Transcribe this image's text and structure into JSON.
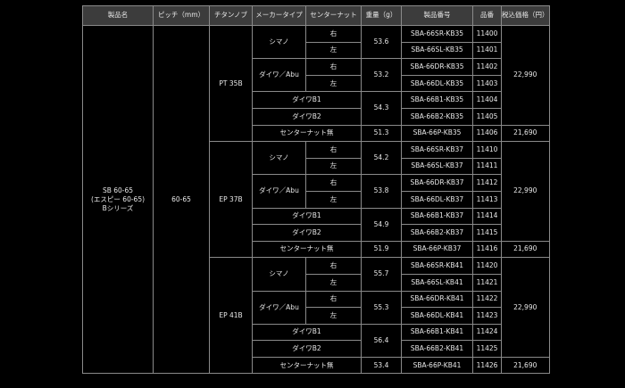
{
  "headers": [
    "製品名",
    "ピッチ（mm）",
    "チタンノブ",
    "メーカータイプ",
    "センターナット",
    "重量（g）",
    "製品番号",
    "品番",
    "税込価格（円）"
  ],
  "product_name": [
    "SB 60-65",
    "(エスピー 60-65)",
    "Bシリーズ"
  ],
  "pitch": "60-65",
  "groups": [
    {
      "knob": "PT 35B",
      "rows": [
        {
          "maker": "シマノ",
          "nut": "右",
          "weight": "53.6",
          "sku": "SBA-66SR-KB35",
          "code": "11400"
        },
        {
          "nut": "左",
          "sku": "SBA-66SL-KB35",
          "code": "11401"
        },
        {
          "maker": "ダイワ／Abu",
          "nut": "右",
          "weight": "53.2",
          "sku": "SBA-66DR-KB35",
          "code": "11402"
        },
        {
          "nut": "左",
          "sku": "SBA-66DL-KB35",
          "code": "11403"
        },
        {
          "maker": "ダイワB1",
          "weight": "54.3",
          "sku": "SBA-66B1-KB35",
          "code": "11404"
        },
        {
          "maker": "ダイワB2",
          "sku": "SBA-66B2-KB35",
          "code": "11405"
        },
        {
          "maker": "センターナット無",
          "weight": "51.3",
          "sku": "SBA-66P-KB35",
          "code": "11406"
        }
      ],
      "price_main": "22,990",
      "price_last": "21,690"
    },
    {
      "knob": "EP 37B",
      "rows": [
        {
          "maker": "シマノ",
          "nut": "右",
          "weight": "54.2",
          "sku": "SBA-66SR-KB37",
          "code": "11410"
        },
        {
          "nut": "左",
          "sku": "SBA-66SL-KB37",
          "code": "11411"
        },
        {
          "maker": "ダイワ／Abu",
          "nut": "右",
          "weight": "53.8",
          "sku": "SBA-66DR-KB37",
          "code": "11412"
        },
        {
          "nut": "左",
          "sku": "SBA-66DL-KB37",
          "code": "11413"
        },
        {
          "maker": "ダイワB1",
          "weight": "54.9",
          "sku": "SBA-66B1-KB37",
          "code": "11414"
        },
        {
          "maker": "ダイワB2",
          "sku": "SBA-66B2-KB37",
          "code": "11415"
        },
        {
          "maker": "センターナット無",
          "weight": "51.9",
          "sku": "SBA-66P-KB37",
          "code": "11416"
        }
      ],
      "price_main": "22,990",
      "price_last": "21,690"
    },
    {
      "knob": "EP 41B",
      "rows": [
        {
          "maker": "シマノ",
          "nut": "右",
          "weight": "55.7",
          "sku": "SBA-66SR-KB41",
          "code": "11420"
        },
        {
          "nut": "左",
          "sku": "SBA-66SL-KB41",
          "code": "11421"
        },
        {
          "maker": "ダイワ／Abu",
          "nut": "右",
          "weight": "55.3",
          "sku": "SBA-66DR-KB41",
          "code": "11422"
        },
        {
          "nut": "左",
          "sku": "SBA-66DL-KB41",
          "code": "11423"
        },
        {
          "maker": "ダイワB1",
          "weight": "56.4",
          "sku": "SBA-66B1-KB41",
          "code": "11424"
        },
        {
          "maker": "ダイワB2",
          "sku": "SBA-66B2-KB41",
          "code": "11425"
        },
        {
          "maker": "センターナット無",
          "weight": "53.4",
          "sku": "SBA-66P-KB41",
          "code": "11426"
        }
      ],
      "price_main": "22,990",
      "price_last": "21,690"
    }
  ]
}
